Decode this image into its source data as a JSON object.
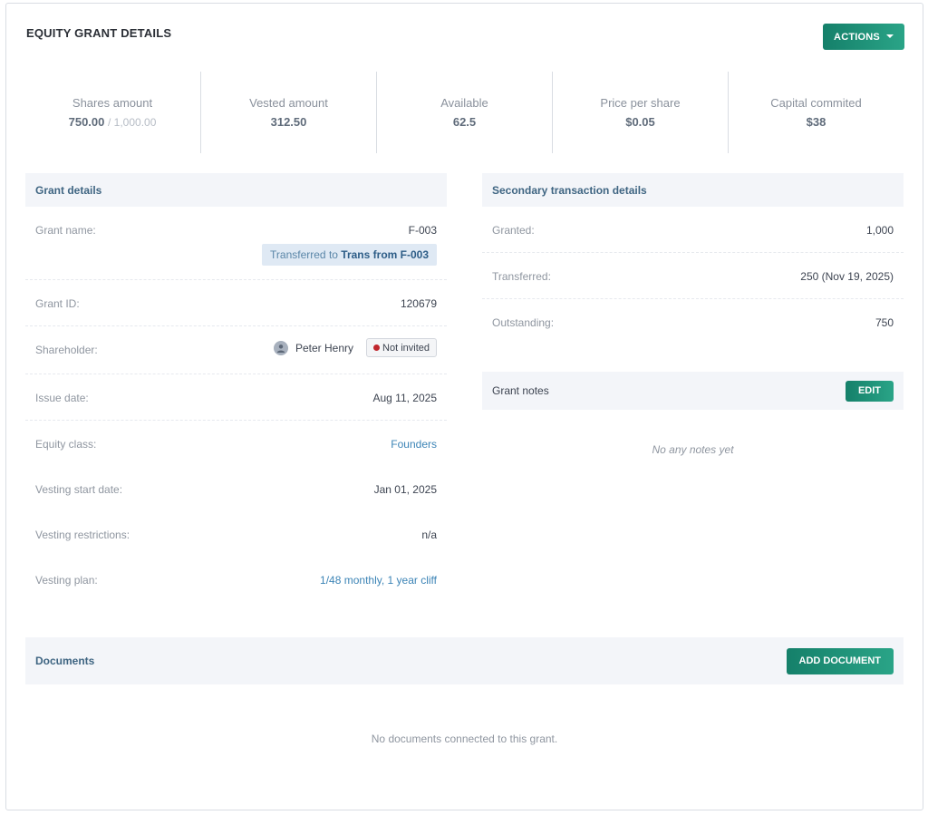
{
  "header": {
    "title": "EQUITY GRANT DETAILS",
    "actions_label": "ACTIONS"
  },
  "stats": {
    "shares_label": "Shares amount",
    "shares_value": "750.00",
    "shares_of": "/ 1,000.00",
    "vested_label": "Vested amount",
    "vested_value": "312.50",
    "available_label": "Available",
    "available_value": "62.5",
    "price_label": "Price per share",
    "price_value": "$0.05",
    "capital_label": "Capital commited",
    "capital_value": "$38"
  },
  "grant": {
    "title": "Grant details",
    "name_label": "Grant name:",
    "name_value": "F-003",
    "transfer_prefix": "Transferred to",
    "transfer_target": "Trans from F-003",
    "id_label": "Grant ID:",
    "id_value": "120679",
    "shareholder_label": "Shareholder:",
    "shareholder_name": "Peter Henry",
    "shareholder_status": "Not invited",
    "issue_label": "Issue date:",
    "issue_value": "Aug 11, 2025",
    "class_label": "Equity class:",
    "class_value": "Founders",
    "vest_start_label": "Vesting start date:",
    "vest_start_value": "Jan 01, 2025",
    "restrictions_label": "Vesting restrictions:",
    "restrictions_value": "n/a",
    "plan_label": "Vesting plan:",
    "plan_value": "1/48 monthly, 1 year cliff"
  },
  "secondary": {
    "title": "Secondary transaction details",
    "granted_label": "Granted:",
    "granted_value": "1,000",
    "transferred_label": "Transferred:",
    "transferred_value": "250 (Nov 19, 2025)",
    "outstanding_label": "Outstanding:",
    "outstanding_value": "750"
  },
  "notes": {
    "title": "Grant notes",
    "edit_label": "EDIT",
    "empty": "No any notes yet"
  },
  "documents": {
    "title": "Documents",
    "add_label": "ADD DOCUMENT",
    "empty": "No documents connected to this grant."
  },
  "colors": {
    "accent": "#1b8a70",
    "link": "#3c84b6",
    "panel_bg": "#f3f5f9",
    "status_dot": "#c0262d"
  },
  "icons": {
    "avatar": "user-icon",
    "actions_caret": "caret-down-icon",
    "status": "status-dot-icon"
  }
}
